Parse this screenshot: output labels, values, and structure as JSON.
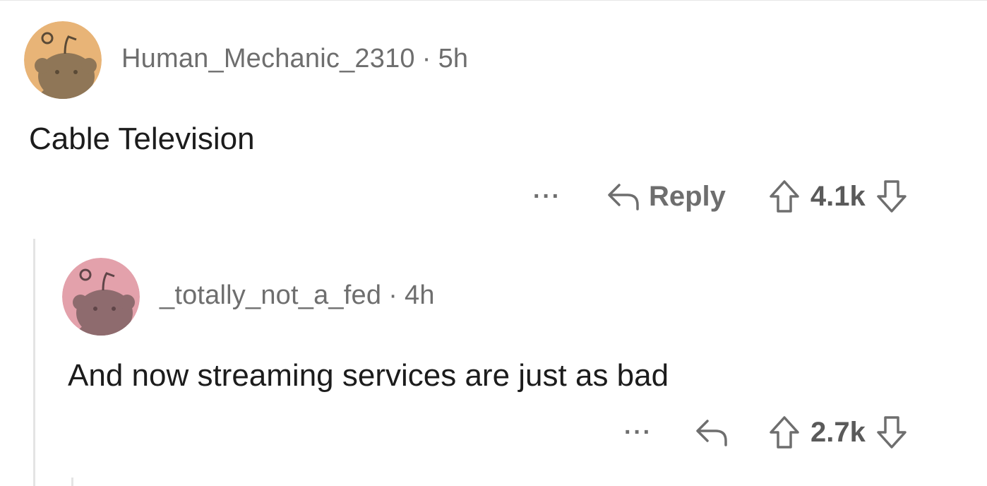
{
  "comments": [
    {
      "username": "Human_Mechanic_2310",
      "separator": "·",
      "time": "5h",
      "text": "Cable Television",
      "avatar_color": "#e8b477",
      "ellipsis": "···",
      "reply_label": "Reply",
      "votes": "4.1k"
    },
    {
      "username": "_totally_not_a_fed",
      "separator": "·",
      "time": "4h",
      "text": "And now streaming services are just as bad",
      "avatar_color": "#e3a1ab",
      "ellipsis": "···",
      "votes": "2.7k"
    }
  ],
  "icons": {
    "avatar": "snoo-avatar-icon",
    "reply": "reply-arrow-icon",
    "upvote": "upvote-arrow-icon",
    "downvote": "downvote-arrow-icon",
    "more": "more-options-icon"
  }
}
